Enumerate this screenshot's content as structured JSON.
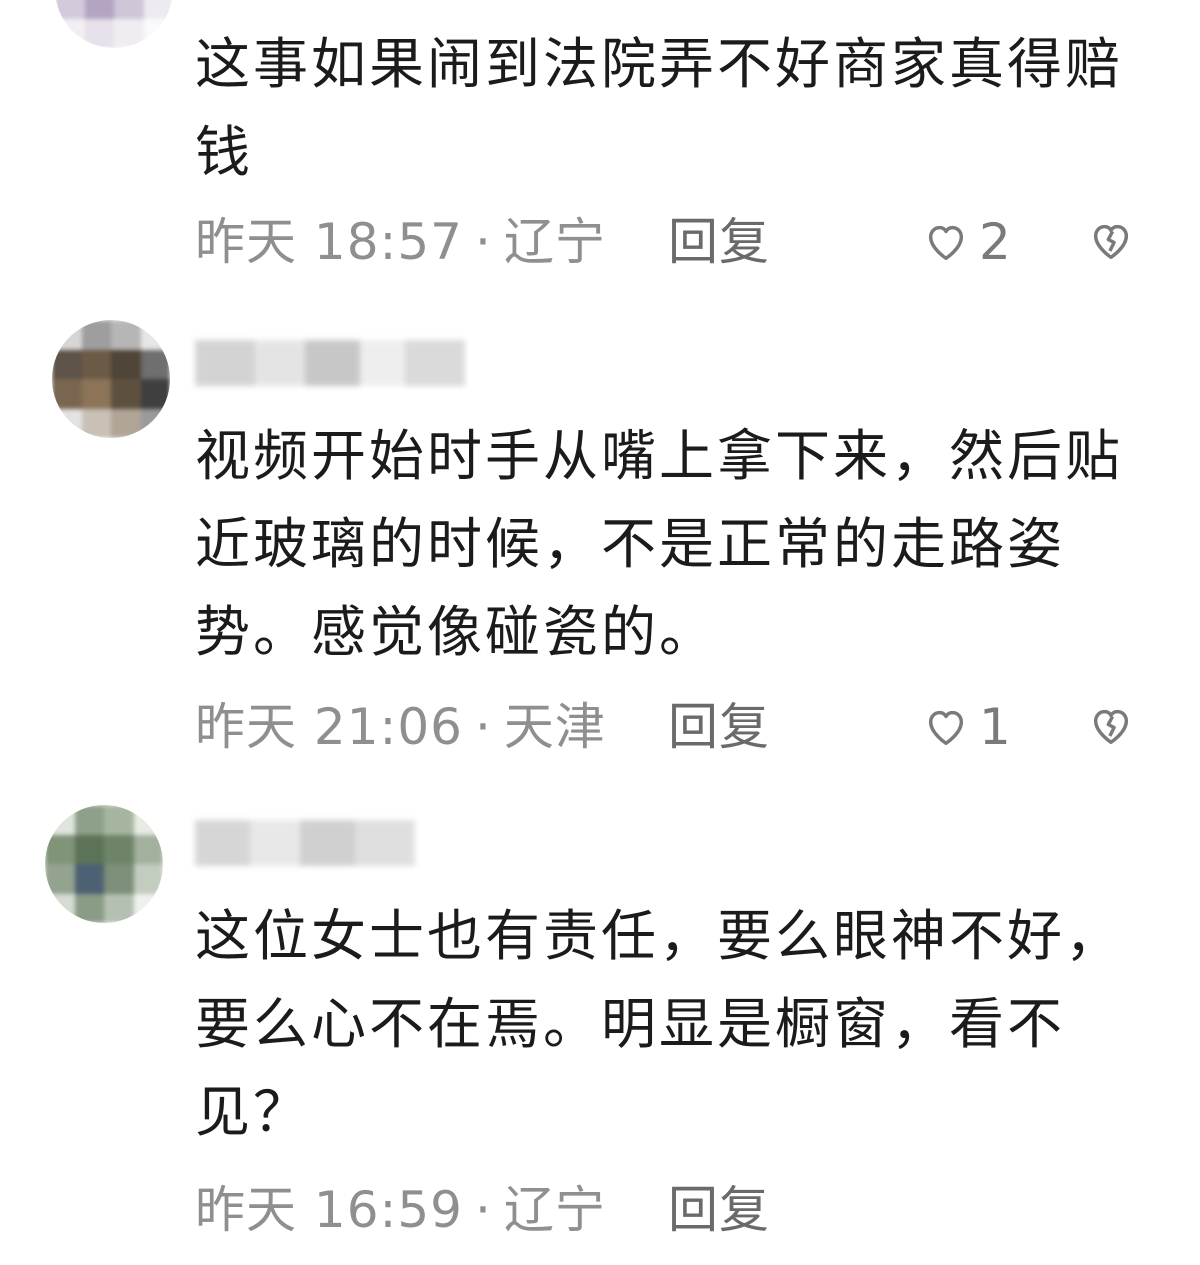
{
  "comments": [
    {
      "text": "这事如果闹到法院弄不好商家真得赔钱",
      "time": "昨天 18:57",
      "location": "辽宁",
      "reply_label": "回复",
      "like_count": "2",
      "like_icon": "heart-outline-icon",
      "dislike_icon": "broken-heart-icon"
    },
    {
      "text": "视频开始时手从嘴上拿下来，然后贴近玻璃的时候，不是正常的走路姿势。感觉像碰瓷的。",
      "time": "昨天 21:06",
      "location": "天津",
      "reply_label": "回复",
      "like_count": "1",
      "like_icon": "heart-outline-icon",
      "dislike_icon": "broken-heart-icon"
    },
    {
      "text": "这位女士也有责任，要么眼神不好，要么心不在焉。明显是橱窗，看不见？",
      "time": "昨天 16:59",
      "location": "辽宁",
      "reply_label": "回复"
    }
  ],
  "separator": "·",
  "colors": {
    "text": "#1b1b1b",
    "meta": "#8f8f8f",
    "reply": "#6a6a6a",
    "icon": "#7a7a7a"
  }
}
